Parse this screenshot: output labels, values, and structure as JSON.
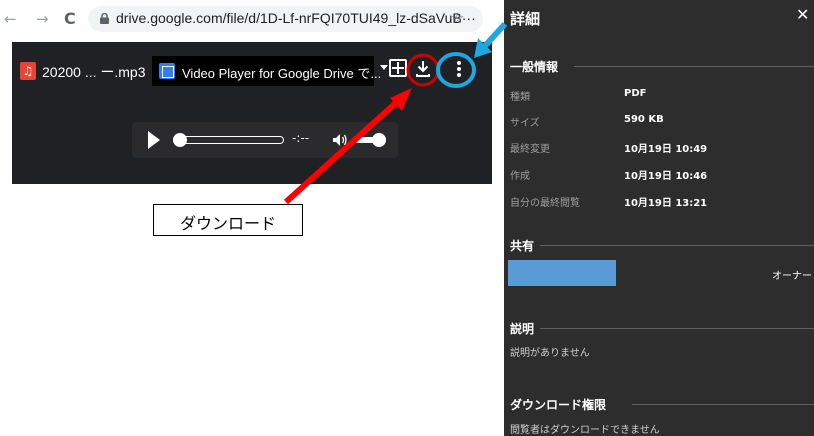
{
  "browser": {
    "back": "←",
    "forward": "→",
    "reload": "C",
    "url": "drive.google.com/file/d/1D-Lf-nrFQI70TUI49_lz-dSaVuB···",
    "star": "☆"
  },
  "viewer": {
    "file_name": "20200 ... ー.mp3",
    "open_with_label": "Video Player for Google Drive で...",
    "audio": {
      "time": "-:--",
      "progress": 0.0,
      "volume": 1.0
    }
  },
  "annotation": {
    "callout": "ダウンロード",
    "colors": {
      "arrow_red": "#ff0000",
      "arrow_blue": "#1ea7e1",
      "circle_red": "#d00000",
      "circle_blue": "#1ea7e1"
    }
  },
  "details": {
    "title": "詳細",
    "close": "✕",
    "general": {
      "heading": "一般情報",
      "rows": [
        {
          "label": "種類",
          "value": "PDF"
        },
        {
          "label": "サイズ",
          "value": "590 KB"
        },
        {
          "label": "最終変更",
          "value": "10月19日 10:49"
        },
        {
          "label": "作成",
          "value": "10月19日 10:46"
        },
        {
          "label": "自分の最終閲覧",
          "value": "10月19日 13:21"
        }
      ]
    },
    "sharing": {
      "heading": "共有",
      "owner": "オーナー"
    },
    "description": {
      "heading": "説明",
      "text": "説明がありません"
    },
    "download_permission": {
      "heading": "ダウンロード権限",
      "text": "閲覧者はダウンロードできません"
    }
  },
  "colors": {
    "panel_bg": "#2d2d2d",
    "viewer_bg": "#202124",
    "share_blue": "#5b9bd5"
  }
}
